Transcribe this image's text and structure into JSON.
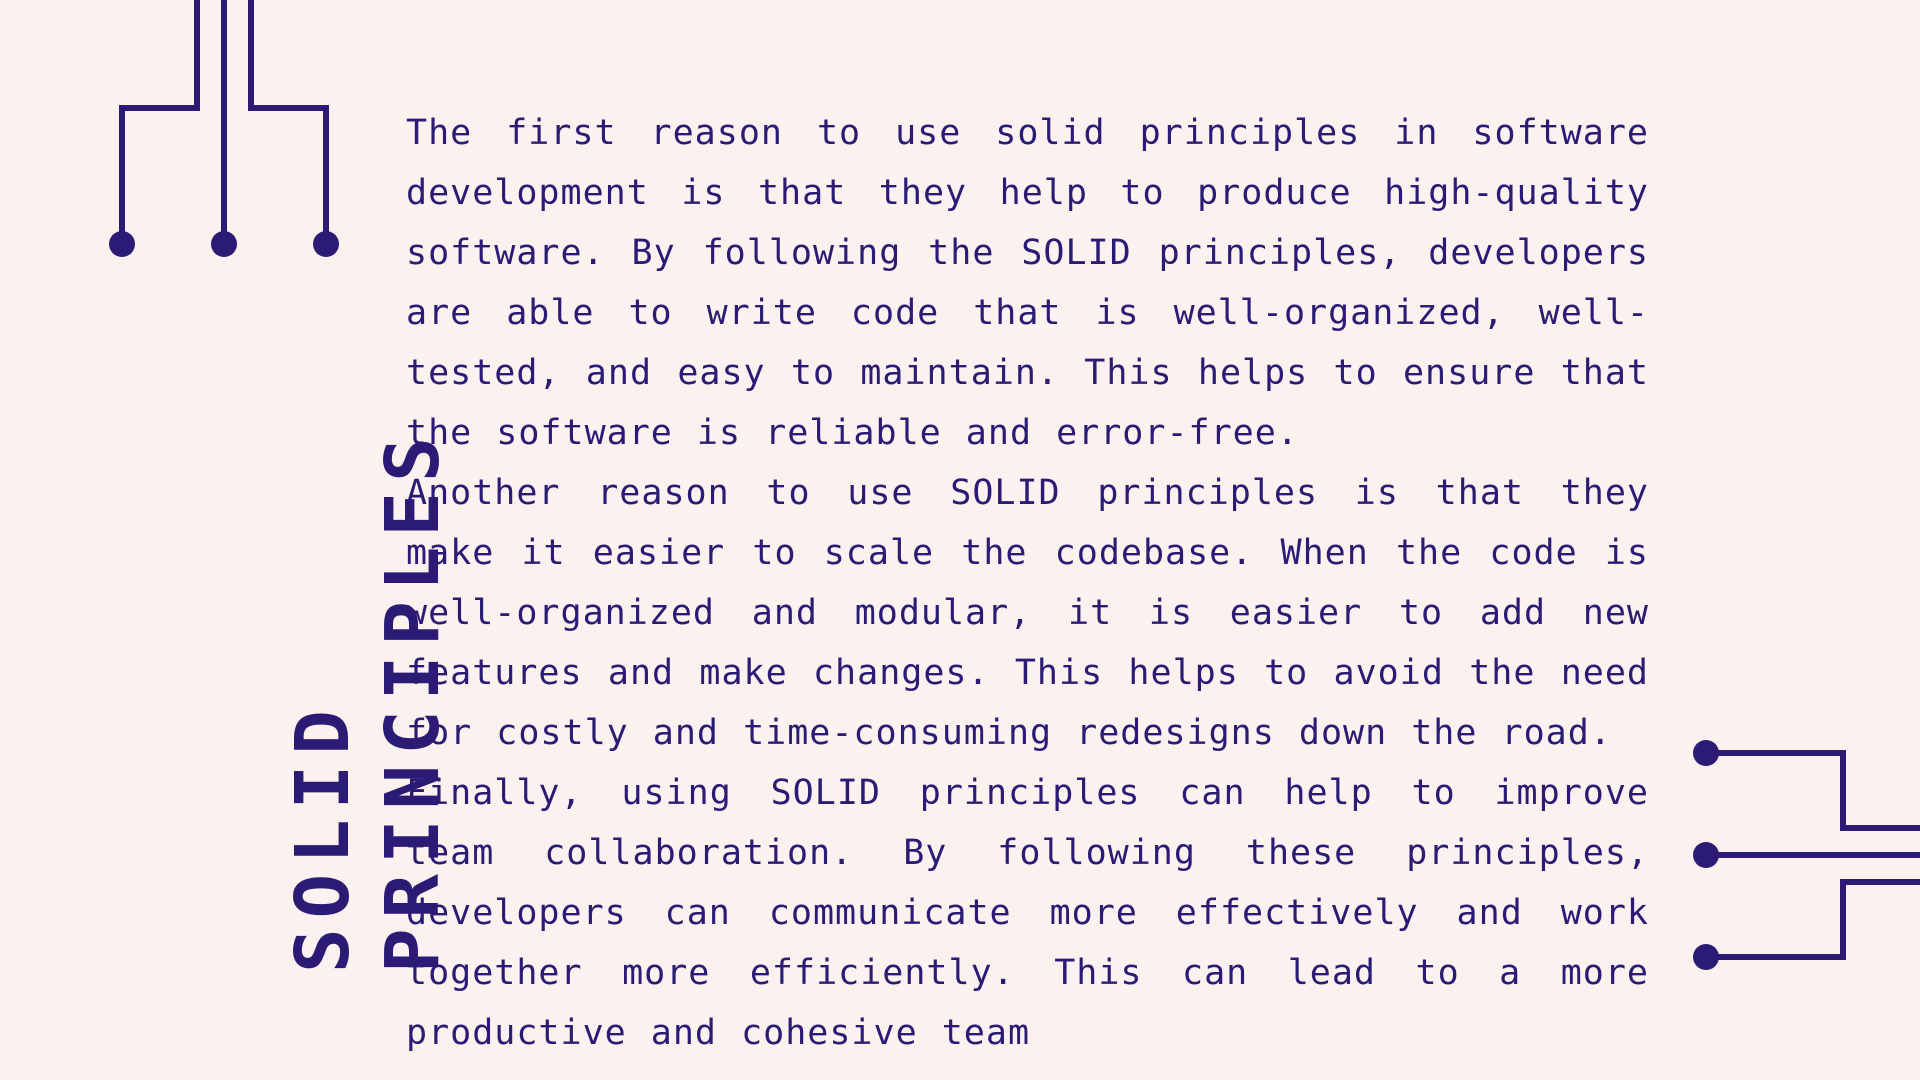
{
  "title": {
    "line1": "SOLID",
    "line2": "PRINCIPLES"
  },
  "paragraphs": [
    "The first reason to use solid principles in software development is that they help to produce high-quality software. By following the SOLID principles, developers are able to write code that is well-organized, well-tested, and easy to maintain. This helps to ensure that the software is reliable and error-free.",
    "Another reason to use SOLID principles is that they make it easier to scale the codebase. When the code is well-organized and modular, it is easier to add new features and make changes. This helps to avoid the need for costly and time-consuming redesigns down the road.",
    "Finally, using SOLID principles can help to improve team collaboration. By following these principles, developers can communicate more effectively and work together more efficiently. This can lead to a more productive and cohesive team"
  ],
  "decorations": {
    "top_left": "circuit-lines-icon",
    "bottom_right": "circuit-lines-icon"
  },
  "colors": {
    "background": "#FBF1EF",
    "accent": "#2B1B75"
  }
}
